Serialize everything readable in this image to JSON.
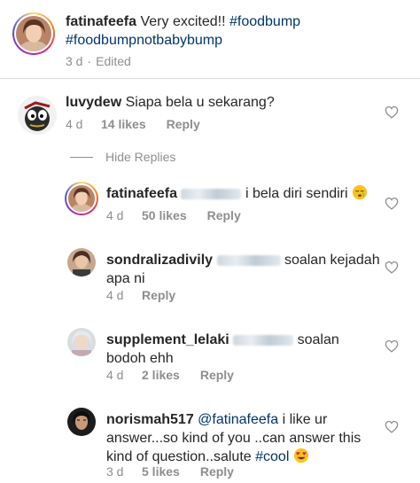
{
  "caption": {
    "username": "fatinafeefa",
    "text": "Very excited!!",
    "hashtag1": "#foodbump",
    "hashtag2": "#foodbumpnotbabybump",
    "time": "3 d",
    "separator": "·",
    "edited": "Edited"
  },
  "comments": [
    {
      "username": "luvydew",
      "text": "Siapa bela u sekarang?",
      "time": "4 d",
      "likes": "14 likes",
      "reply": "Reply"
    }
  ],
  "hide_replies_label": "Hide Replies",
  "replies": [
    {
      "username": "fatinafeefa",
      "text": "i bela diri sendiri",
      "emoji": "sleepy-face",
      "time": "4 d",
      "likes": "50 likes",
      "reply": "Reply"
    },
    {
      "username": "sondralizadivily",
      "text_line1": "soalan kejadah",
      "text_line2": "apa ni",
      "time": "4 d",
      "reply": "Reply"
    },
    {
      "username": "supplement_lelaki",
      "text_line1": "soalan",
      "text_line2": "bodoh ehh",
      "time": "4 d",
      "likes": "2 likes",
      "reply": "Reply"
    },
    {
      "username": "norismah517",
      "mention": "@fatinafeefa",
      "text_line1": "i like ur",
      "text_line2": "answer...so kind of you ..can answer this",
      "text_line3": "kind of question..salute",
      "hashtag": "#cool",
      "emoji": "heart-eyes",
      "time": "3 d",
      "likes": "5 likes",
      "reply": "Reply"
    }
  ],
  "colors": {
    "text": "#262626",
    "meta": "#8e8e8e",
    "hashtag": "#003569",
    "divider": "#dbdbdb"
  }
}
